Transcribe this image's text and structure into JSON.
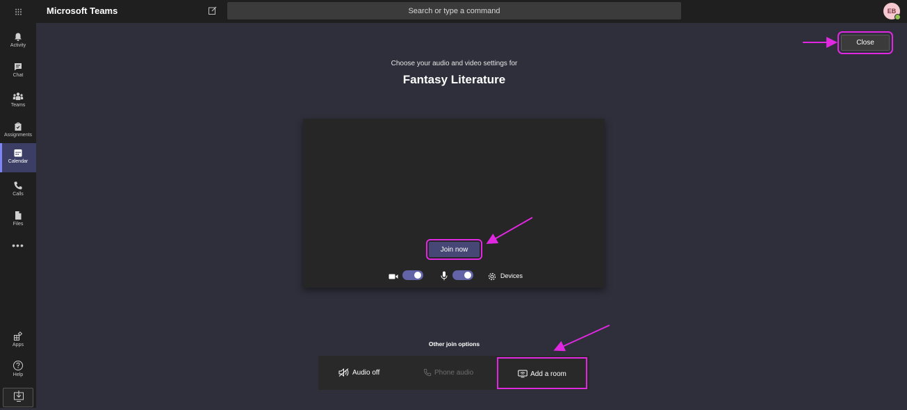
{
  "header": {
    "app_title": "Microsoft Teams",
    "search_placeholder": "Search or type a command",
    "avatar_initials": "EB"
  },
  "rail": {
    "items": [
      {
        "label": "Activity",
        "icon": "bell-icon"
      },
      {
        "label": "Chat",
        "icon": "chat-icon"
      },
      {
        "label": "Teams",
        "icon": "teams-icon"
      },
      {
        "label": "Assignments",
        "icon": "assignments-icon"
      },
      {
        "label": "Calendar",
        "icon": "calendar-icon",
        "active": true
      },
      {
        "label": "Calls",
        "icon": "phone-icon"
      },
      {
        "label": "Files",
        "icon": "file-icon"
      }
    ],
    "more": "•••",
    "apps_label": "Apps",
    "help_label": "Help"
  },
  "prejoin": {
    "close_label": "Close",
    "subtitle": "Choose your audio and video settings for",
    "meeting_title": "Fantasy Literature",
    "join_label": "Join now",
    "camera_on": true,
    "mic_on": true,
    "devices_label": "Devices",
    "other_title": "Other join options",
    "options": {
      "audio_off": "Audio off",
      "phone_audio": "Phone audio",
      "add_room": "Add a room"
    }
  },
  "colors": {
    "accent": "#6264a7",
    "highlight": "#e028e0",
    "background": "#2f2f3b"
  }
}
